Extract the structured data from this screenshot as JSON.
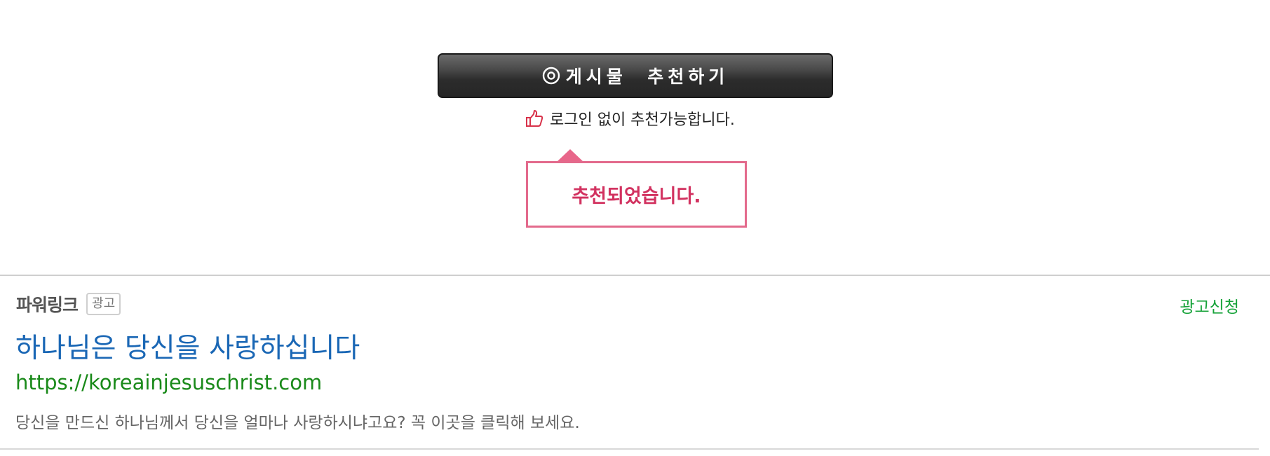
{
  "recommend": {
    "button_label": "게시물  추천하기",
    "hint": "로그인 없이 추천가능합니다.",
    "confirmation": "추천되었습니다."
  },
  "powerlink": {
    "title": "파워링크",
    "badge": "광고",
    "apply_label": "광고신청",
    "ad": {
      "title": "하나님은 당신을 사랑하십니다",
      "url": "https://koreainjesuschrist.com",
      "description": "당신을 만드신 하나님께서 당신을 얼마나 사랑하시냐고요? 꼭 이곳을 클릭해 보세요."
    }
  },
  "colors": {
    "button_bg": "#2c2c2c",
    "tooltip_border": "#e36a8c",
    "tooltip_text": "#d23260",
    "ad_title": "#1a67b5",
    "ad_url": "#1a8a1a",
    "apply_link": "#17a33a"
  },
  "icons": {
    "button_icon": "target-circle-icon",
    "hint_icon": "thumbs-up-icon"
  }
}
